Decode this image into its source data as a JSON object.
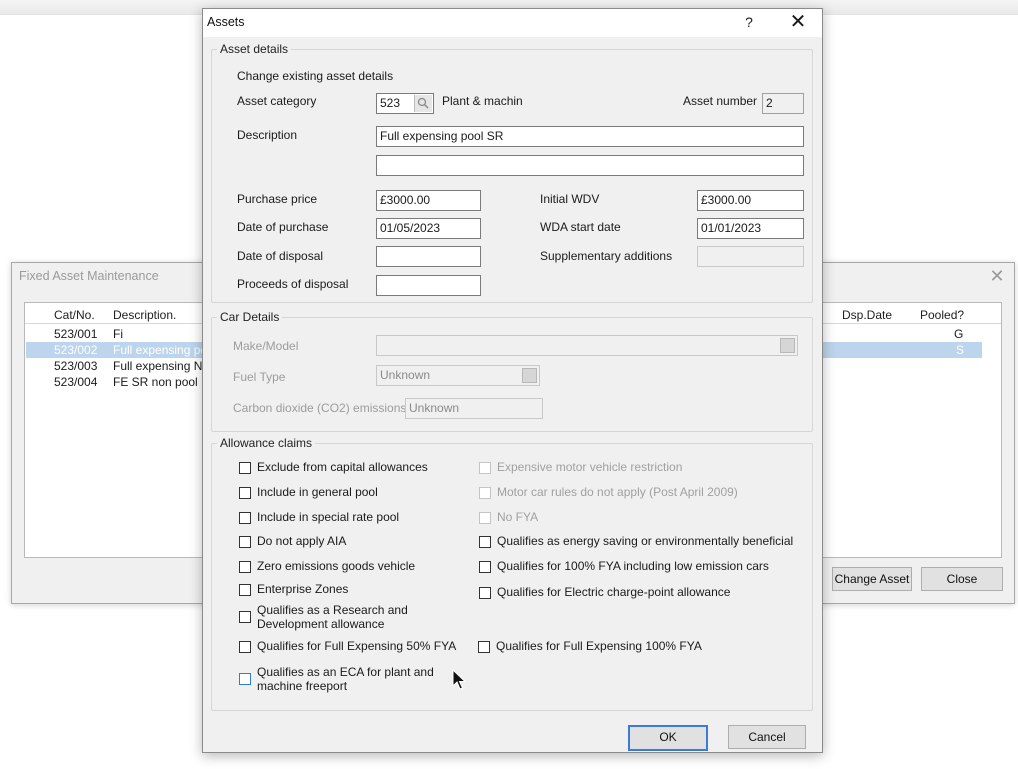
{
  "background_window": {
    "title": "Fixed Asset Maintenance",
    "close_glyph": "✕",
    "columns": {
      "cat_no": "Cat/No.",
      "description": "Description.",
      "dsp_date": "Dsp.Date",
      "pooled": "Pooled?"
    },
    "rows": [
      {
        "cat_no": "523/001",
        "description": "Fi",
        "pooled": "G",
        "selected": false
      },
      {
        "cat_no": "523/002",
        "description": "Full expensing pool",
        "pooled": "S",
        "selected": true
      },
      {
        "cat_no": "523/003",
        "description": "Full expensing Non",
        "pooled": "",
        "selected": false
      },
      {
        "cat_no": "523/004",
        "description": "FE SR non pool",
        "pooled": "",
        "selected": false
      }
    ],
    "buttons": {
      "change_asset": "Change Asset",
      "close": "Close"
    }
  },
  "dialog": {
    "title": "Assets",
    "help_glyph": "?",
    "close_glyph": "✕",
    "asset_details": {
      "legend": "Asset details",
      "subtitle": "Change existing asset details",
      "asset_category_label": "Asset category",
      "asset_category_code": "523",
      "asset_category_name": "Plant & machin",
      "asset_number_label": "Asset number",
      "asset_number": "2",
      "description_label": "Description",
      "description_line1": "Full expensing pool SR",
      "description_line2": "",
      "purchase_price_label": "Purchase price",
      "purchase_price": "£3000.00",
      "date_of_purchase_label": "Date of purchase",
      "date_of_purchase": "01/05/2023",
      "date_of_disposal_label": "Date of disposal",
      "date_of_disposal": "",
      "proceeds_of_disposal_label": "Proceeds of disposal",
      "proceeds_of_disposal": "",
      "initial_wdv_label": "Initial WDV",
      "initial_wdv": "£3000.00",
      "wda_start_date_label": "WDA start date",
      "wda_start_date": "01/01/2023",
      "supplementary_additions_label": "Supplementary additions",
      "supplementary_additions": ""
    },
    "car_details": {
      "legend": "Car Details",
      "make_model_label": "Make/Model",
      "make_model": "",
      "fuel_type_label": "Fuel Type",
      "fuel_type": "Unknown",
      "co2_label": "Carbon dioxide (CO2) emissions",
      "co2": "Unknown"
    },
    "allowance_claims": {
      "legend": "Allowance claims",
      "left": [
        {
          "label": "Exclude from capital allowances",
          "checked": false,
          "enabled": true
        },
        {
          "label": "Include in general pool",
          "checked": false,
          "enabled": true
        },
        {
          "label": "Include in special rate pool",
          "checked": false,
          "enabled": true
        },
        {
          "label": "Do not apply AIA",
          "checked": false,
          "enabled": true
        },
        {
          "label": "Zero emissions goods vehicle",
          "checked": false,
          "enabled": true
        },
        {
          "label": "Enterprise Zones",
          "checked": false,
          "enabled": true
        },
        {
          "label": "Qualifies as a Research and",
          "label2": "Development allowance",
          "checked": false,
          "enabled": true
        },
        {
          "label": "Qualifies for Full Expensing 50% FYA",
          "checked": false,
          "enabled": true
        },
        {
          "label": "Qualifies as an ECA for plant and",
          "label2": "machine freeport",
          "checked": false,
          "enabled": true,
          "focused": true
        }
      ],
      "right": [
        {
          "label": "Expensive motor vehicle restriction",
          "checked": false,
          "enabled": false
        },
        {
          "label": "Motor car rules do not apply (Post April 2009)",
          "checked": false,
          "enabled": false
        },
        {
          "label": "No FYA",
          "checked": false,
          "enabled": false
        },
        {
          "label": "Qualifies as energy saving or environmentally beneficial",
          "checked": false,
          "enabled": true
        },
        {
          "label": "Qualifies for 100% FYA including low emission cars",
          "checked": false,
          "enabled": true
        },
        {
          "label": "Qualifies for Electric charge-point allowance",
          "checked": false,
          "enabled": true
        },
        {
          "label": "Qualifies for Full Expensing 100% FYA",
          "checked": false,
          "enabled": true
        }
      ]
    },
    "buttons": {
      "ok": "OK",
      "cancel": "Cancel"
    }
  }
}
